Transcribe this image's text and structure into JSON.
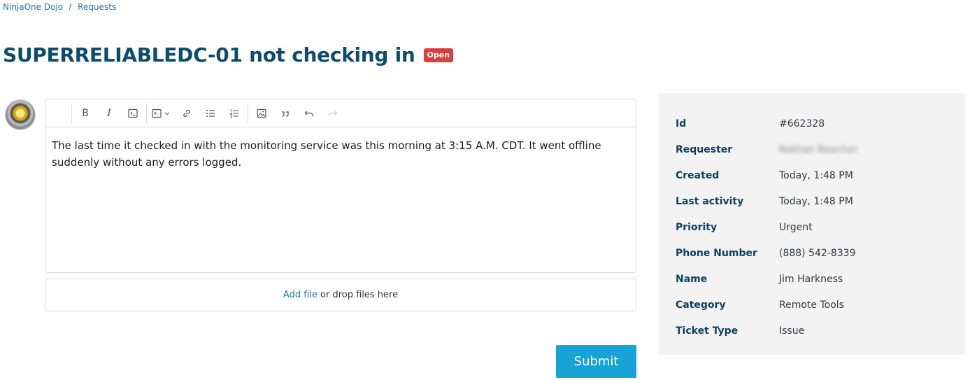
{
  "breadcrumb": {
    "home": "NinjaOne Dojo",
    "separator": "/",
    "current": "Requests"
  },
  "request": {
    "title": "SUPERRELIABLEDC-01 not checking in",
    "status": "Open",
    "status_color": "#d93f3f"
  },
  "editor": {
    "toolbar": [
      {
        "name": "bold-icon",
        "glyph": "B"
      },
      {
        "name": "italic-icon",
        "glyph": "I"
      },
      {
        "name": "code-icon"
      },
      {
        "name": "code-block-icon"
      },
      {
        "name": "link-icon"
      },
      {
        "name": "bullet-list-icon"
      },
      {
        "name": "numbered-list-icon"
      },
      {
        "name": "image-icon"
      },
      {
        "name": "quote-icon"
      },
      {
        "name": "undo-icon"
      },
      {
        "name": "redo-icon"
      }
    ],
    "content": "The last time it checked in with the monitoring service was this morning at 3:15 A.M. CDT. It went offline suddenly without any errors logged."
  },
  "attachments": {
    "add_file": "Add file",
    "drop_text": "or drop files here"
  },
  "submit_label": "Submit",
  "details": [
    {
      "label": "Id",
      "value": "#662328"
    },
    {
      "label": "Requester",
      "value": "Nathan Reacher",
      "blurred": true
    },
    {
      "label": "Created",
      "value": "Today, 1:48 PM"
    },
    {
      "label": "Last activity",
      "value": "Today, 1:48 PM"
    },
    {
      "label": "Priority",
      "value": "Urgent"
    },
    {
      "label": "Phone Number",
      "value": "(888) 542-8339"
    },
    {
      "label": "Name",
      "value": "Jim Harkness"
    },
    {
      "label": "Category",
      "value": "Remote Tools"
    },
    {
      "label": "Ticket Type",
      "value": "Issue"
    }
  ]
}
